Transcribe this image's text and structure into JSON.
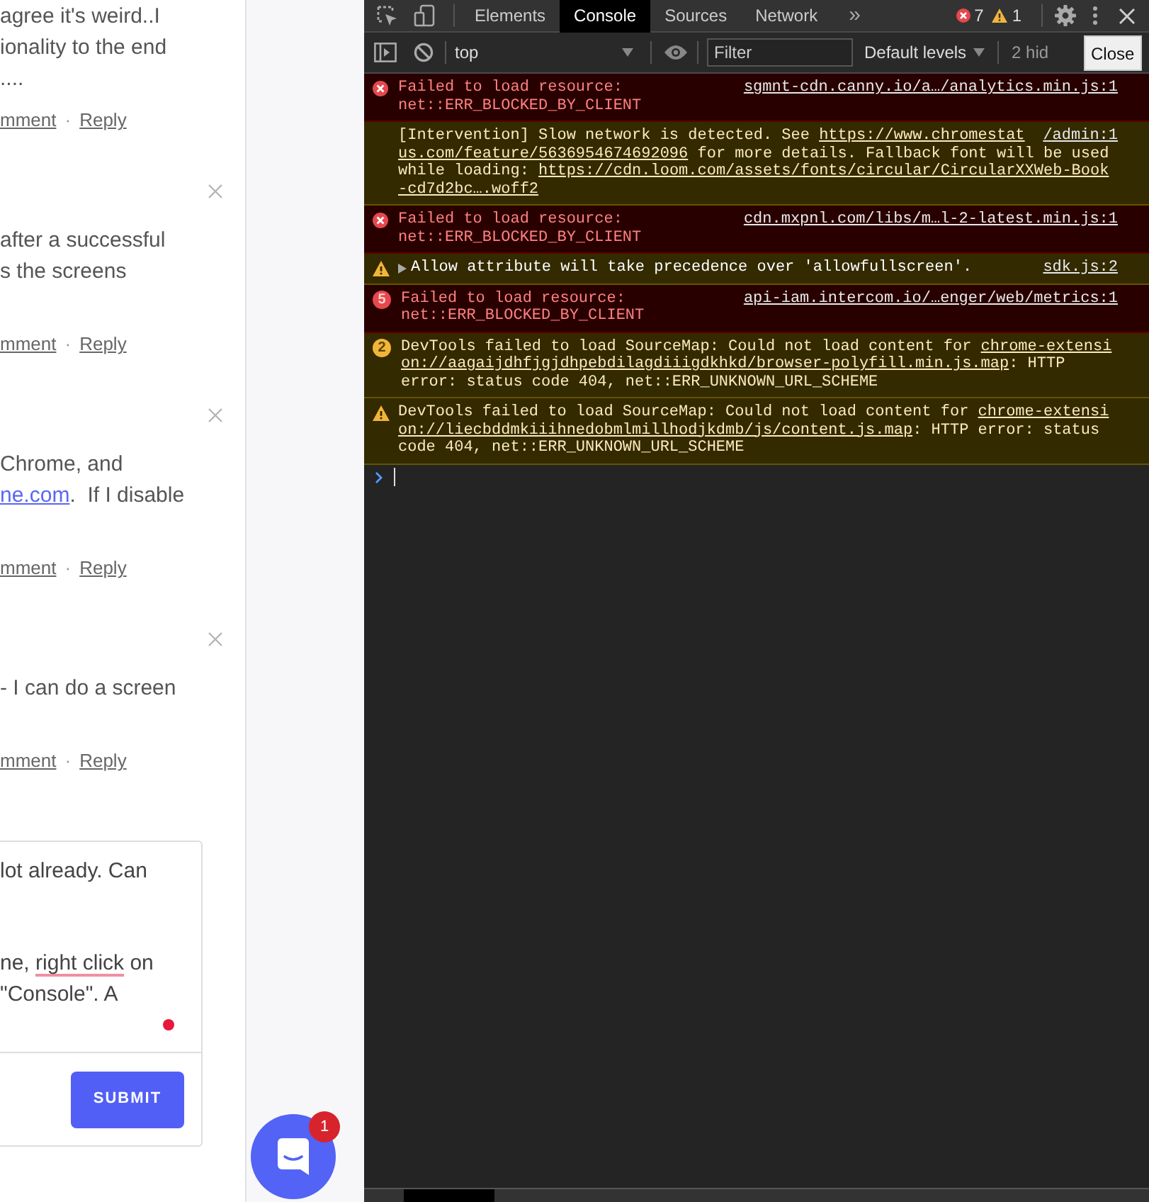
{
  "comments": [
    {
      "dismiss_icon": false,
      "lines": [
        [
          {
            "text": "agree it's weird..I",
            "kind": "text"
          }
        ],
        [
          {
            "text": "ionality to the end",
            "kind": "text"
          }
        ],
        [
          {
            "text": "....",
            "kind": "text"
          }
        ]
      ],
      "actions": [
        "mment",
        "Reply"
      ],
      "separator": "·"
    },
    {
      "dismiss_icon": true,
      "lines": [
        [
          {
            "text": "after a successful",
            "kind": "text"
          }
        ],
        [
          {
            "text": "s the screens",
            "kind": "text"
          }
        ]
      ],
      "actions": [
        "mment",
        "Reply"
      ],
      "separator": "·"
    },
    {
      "dismiss_icon": true,
      "lines": [
        [
          {
            "text": "Chrome, and",
            "kind": "text"
          }
        ],
        [
          {
            "text": "ne.com",
            "kind": "link"
          },
          {
            "text": ".  If I disable",
            "kind": "text"
          }
        ]
      ],
      "actions": [
        "mment",
        "Reply"
      ],
      "separator": "·"
    },
    {
      "dismiss_icon": true,
      "lines": [
        [
          {
            "text": "- I can do a screen",
            "kind": "text"
          }
        ]
      ],
      "actions": [
        "mment",
        "Reply"
      ],
      "separator": "·"
    }
  ],
  "composer": {
    "paragraphs": [
      [
        [
          {
            "text": "lot already. Can",
            "kind": "plain"
          }
        ]
      ],
      [
        [
          {
            "text": "ne, ",
            "kind": "plain"
          },
          {
            "text": "right click",
            "kind": "misspelled"
          },
          {
            "text": " on",
            "kind": "plain"
          }
        ],
        [
          {
            "text": "\"Console\". A",
            "kind": "plain"
          }
        ]
      ]
    ],
    "submit": "SUBMIT"
  },
  "chat_launcher": {
    "badge": "1"
  },
  "devtools": {
    "tabs": [
      {
        "label": "Elements",
        "selected": false
      },
      {
        "label": "Console",
        "selected": true
      },
      {
        "label": "Sources",
        "selected": false
      },
      {
        "label": "Network",
        "selected": false
      }
    ],
    "more_tabs": "»",
    "error_count": "7",
    "warning_count": "1",
    "context": "top",
    "filter_placeholder": "Filter",
    "levels": "Default levels",
    "hidden_count": "2 hid",
    "tooltip": "Close",
    "messages": [
      {
        "kind": "error",
        "expandable": false,
        "src": "sgmnt-cdn.canny.io/a…/analytics.min.js:1",
        "lines": [
          [
            {
              "text": "Failed to load resource:",
              "kind": "text"
            }
          ],
          [
            {
              "text": "net::ERR_BLOCKED_BY_CLIENT",
              "kind": "text"
            }
          ]
        ]
      },
      {
        "kind": "intervention",
        "expandable": false,
        "src": "/admin:1",
        "lines": [
          [
            {
              "text": "[Intervention] Slow network is detected. See ",
              "kind": "text"
            },
            {
              "text": "https://www.chromestat",
              "kind": "link"
            }
          ],
          [
            {
              "text": "us.com/feature/5636954674692096",
              "kind": "link"
            },
            {
              "text": " for more details. Fallback font will be used",
              "kind": "text"
            }
          ],
          [
            {
              "text": "while loading: ",
              "kind": "text"
            },
            {
              "text": "https://cdn.loom.com/assets/fonts/circular/CircularXXWeb-Book",
              "kind": "link"
            }
          ],
          [
            {
              "text": "-cd7d2bc….woff2",
              "kind": "link"
            }
          ]
        ]
      },
      {
        "kind": "error",
        "expandable": false,
        "src": "cdn.mxpnl.com/libs/m…l-2-latest.min.js:1",
        "lines": [
          [
            {
              "text": "Failed to load resource:",
              "kind": "text"
            }
          ],
          [
            {
              "text": "net::ERR_BLOCKED_BY_CLIENT",
              "kind": "text"
            }
          ]
        ]
      },
      {
        "kind": "warning",
        "expandable": true,
        "src": "sdk.js:2",
        "lines": [
          [
            {
              "text": "Allow attribute will take precedence over 'allowfullscreen'.",
              "kind": "text"
            }
          ]
        ]
      },
      {
        "kind": "error",
        "expandable": false,
        "count": "5",
        "src": "api-iam.intercom.io/…enger/web/metrics:1",
        "lines": [
          [
            {
              "text": "Failed to load resource:",
              "kind": "text"
            }
          ],
          [
            {
              "text": "net::ERR_BLOCKED_BY_CLIENT",
              "kind": "text"
            }
          ]
        ]
      },
      {
        "kind": "warning",
        "expandable": false,
        "count": "2",
        "lines": [
          [
            {
              "text": "DevTools failed to load SourceMap: Could not load content for ",
              "kind": "text"
            },
            {
              "text": "chrome-extensi",
              "kind": "link"
            }
          ],
          [
            {
              "text": "on://aagaijdhfjgjdhpebdilagdiiigdkhkd/browser-polyfill.min.js.map",
              "kind": "link"
            },
            {
              "text": ": HTTP",
              "kind": "text"
            }
          ],
          [
            {
              "text": "error: status code 404, net::ERR_UNKNOWN_URL_SCHEME",
              "kind": "text"
            }
          ]
        ]
      },
      {
        "kind": "warning",
        "expandable": false,
        "lines": [
          [
            {
              "text": "DevTools failed to load SourceMap: Could not load content for ",
              "kind": "text"
            },
            {
              "text": "chrome-extensi",
              "kind": "link"
            }
          ],
          [
            {
              "text": "on://liecbddmkiiihnedobmlmillhodjkdmb/js/content.js.map",
              "kind": "link"
            },
            {
              "text": ": HTTP error: status",
              "kind": "text"
            }
          ],
          [
            {
              "text": "code 404, net::ERR_UNKNOWN_URL_SCHEME",
              "kind": "text"
            }
          ]
        ]
      }
    ]
  }
}
